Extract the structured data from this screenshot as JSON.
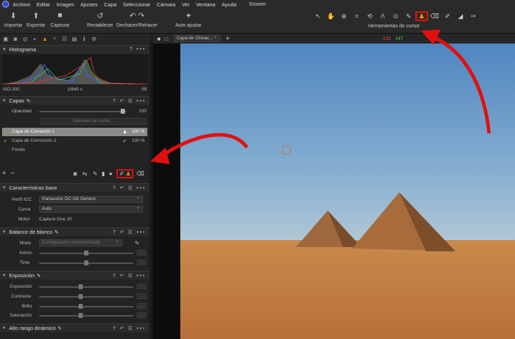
{
  "app": {
    "title": "Dzoom"
  },
  "menu": [
    "Archivo",
    "Editar",
    "Imagen",
    "Ajustes",
    "Capa",
    "Seleccionar",
    "Cámara",
    "Ver",
    "Ventana",
    "Ayuda"
  ],
  "toolbar": {
    "import": "Importar",
    "export": "Exportar",
    "capture": "Capturar",
    "reset": "Restablecer",
    "undo_redo": "Deshacer/Rehacer",
    "auto": "Auto ajustar",
    "cursor_tools_label": "Herramientas de cursor"
  },
  "viewer": {
    "layer_select": "Capa de Clonac...",
    "readout_r": "130",
    "readout_g": "147"
  },
  "histogram": {
    "title": "Histograma",
    "iso": "ISO 200",
    "shutter": "1/640 s",
    "aperture": "f/8"
  },
  "layers": {
    "title": "Capas",
    "opacity_label": "Opacidad",
    "opacity_value": "100",
    "luma_button": "Intervalo de Luma...",
    "items": [
      {
        "name": "Capa de Clonación 1",
        "value": "100 %"
      },
      {
        "name": "Capa de Corrección 1",
        "value": "100 %"
      },
      {
        "name": "Fondo",
        "value": ""
      }
    ]
  },
  "base": {
    "title": "Características base",
    "icc_label": "Perfil ICC",
    "icc_value": "Panasonic DC-G9 Generic",
    "curve_label": "Curva",
    "curve_value": "Auto",
    "engine_label": "Motor",
    "engine_value": "Capture One 20"
  },
  "wb": {
    "title": "Balance de blanco",
    "mode_label": "Modo",
    "mode_value": "Configuración personalizada",
    "kelvin_label": "Kelvin",
    "tint_label": "Tinte"
  },
  "exposure": {
    "title": "Exposición",
    "labels": [
      "Exposición",
      "Contraste",
      "Brillo",
      "Saturación"
    ]
  },
  "hdr": {
    "title": "Alto rango dinámico"
  },
  "colors": {
    "accent": "#f08a00",
    "highlight": "#e01010",
    "r_readout": "#e04040",
    "g_readout": "#40d040"
  }
}
